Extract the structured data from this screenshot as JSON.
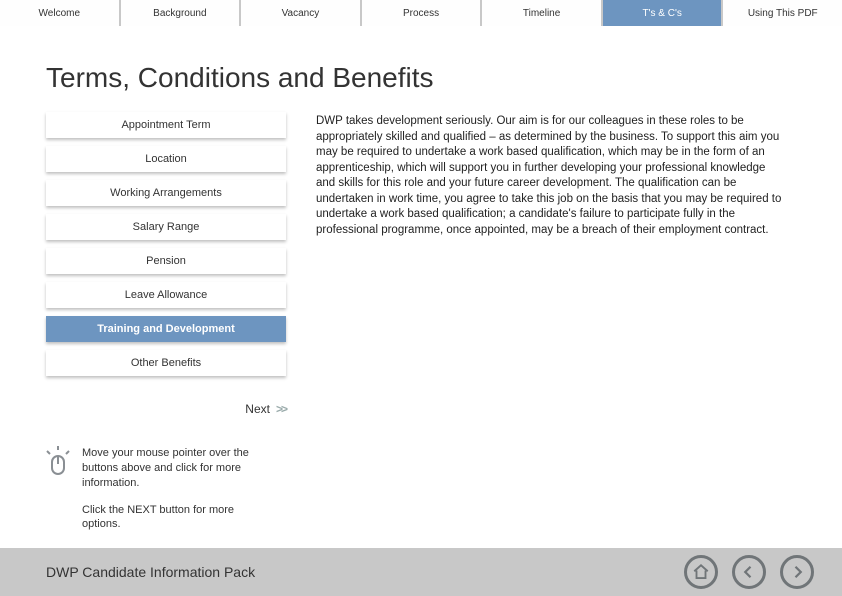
{
  "tabs": [
    {
      "label": "Welcome"
    },
    {
      "label": "Background"
    },
    {
      "label": "Vacancy"
    },
    {
      "label": "Process"
    },
    {
      "label": "Timeline"
    },
    {
      "label": "T's & C's",
      "active": true
    },
    {
      "label": "Using This PDF"
    }
  ],
  "page_title": "Terms, Conditions and Benefits",
  "sidebar": [
    {
      "label": "Appointment Term"
    },
    {
      "label": "Location"
    },
    {
      "label": "Working Arrangements"
    },
    {
      "label": "Salary Range"
    },
    {
      "label": "Pension"
    },
    {
      "label": "Leave Allowance"
    },
    {
      "label": "Training and Development",
      "active": true
    },
    {
      "label": "Other Benefits"
    }
  ],
  "body_text": "DWP takes development seriously. Our aim is for our colleagues in these roles to be appropriately skilled and qualified – as determined by the business. To support this aim you may be required to undertake a work based qualification, which may be in the form of an apprenticeship, which will support you in further developing your professional knowledge and skills for this role and your future career development. The qualification can be undertaken in work time, you agree to take this job on the basis that you may be required to undertake a work based qualification; a candidate's failure to participate fully in the professional programme, once appointed, may be a breach of their employment contract.",
  "next_label": "Next",
  "hint": {
    "line1": "Move your mouse pointer over the buttons above and click for more information.",
    "line2": "Click the NEXT button for more options."
  },
  "footer_title": "DWP Candidate Information Pack"
}
